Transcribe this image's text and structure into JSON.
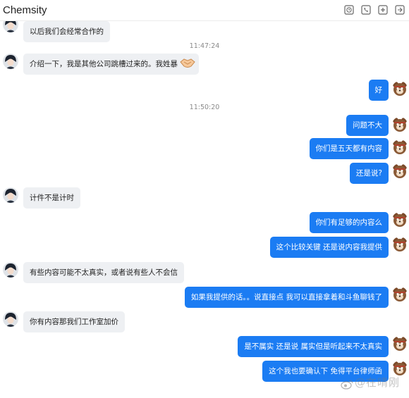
{
  "window": {
    "title": "Chemsity"
  },
  "toolbar": {
    "icons": [
      "clock-icon",
      "phone-icon",
      "add-icon",
      "more-window-icon"
    ]
  },
  "colors": {
    "accent": "#1b7cf3",
    "bubble_left": "#eef0f3"
  },
  "messages": [
    {
      "side": "left",
      "text": "以后我们会经常合作的"
    },
    {
      "side": "time",
      "text": "11:47:24"
    },
    {
      "side": "left",
      "text": "介绍一下，我是其他公司跳槽过来的。我姓暴",
      "emoji": "handshake-emoji"
    },
    {
      "side": "right",
      "text": "好"
    },
    {
      "side": "time",
      "text": "11:50:20"
    },
    {
      "side": "right",
      "text": "问题不大"
    },
    {
      "side": "right",
      "text": "你们是五天都有内容"
    },
    {
      "side": "right",
      "text": "还是说?"
    },
    {
      "side": "left",
      "text": "计件不是计时"
    },
    {
      "side": "right",
      "text": "你们有足够的内容么"
    },
    {
      "side": "right",
      "text": "这个比较关键 还是说内容我提供"
    },
    {
      "side": "left",
      "text": "有些内容可能不太真实，或者说有些人不会信"
    },
    {
      "side": "right",
      "text": "如果我提供的话。。说直接点 我可以直接拿着和斗鱼聊钱了"
    },
    {
      "side": "left",
      "text": "你有内容那我们工作室加价"
    },
    {
      "side": "right",
      "text": "是不属实 还是说 属实但是听起来不太真实"
    },
    {
      "side": "right",
      "text": "这个我也要确认下 免得平台律师函"
    }
  ],
  "watermark": {
    "text": "@在晴刚"
  }
}
